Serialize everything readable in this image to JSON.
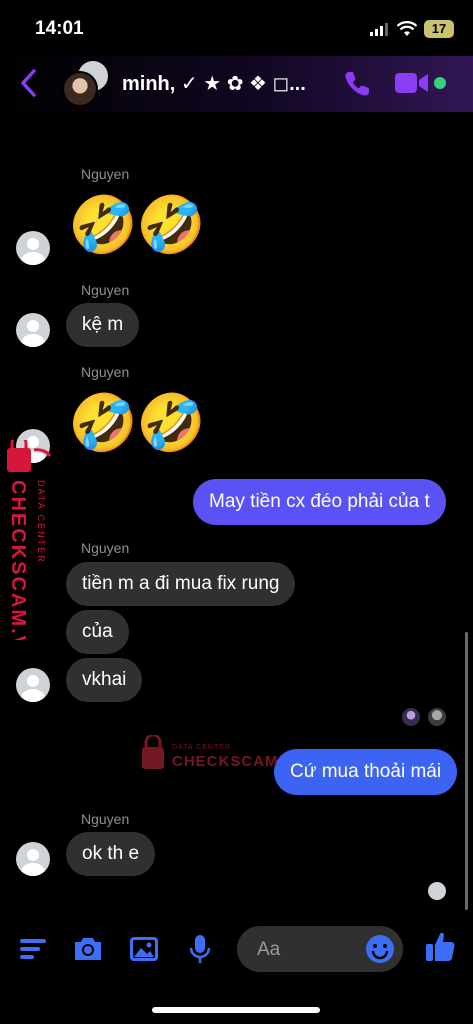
{
  "status_bar": {
    "time": "14:01",
    "battery": "17"
  },
  "header": {
    "title": "minh, ✓ ★ ✿ ❖ ◻..."
  },
  "colors": {
    "accent": "#8b3cf5",
    "bubble_out": "#5b52f6",
    "bubble_out_2": "#3c63f2",
    "bubble_in": "#303030",
    "online": "#35d07f",
    "watermark": "#d6173b"
  },
  "messages": {
    "top_emojis": "🤣🤣🤣",
    "sender_1": "Nguyen",
    "emojis_1": [
      "🤣",
      "🤣"
    ],
    "sender_2": "Nguyen",
    "msg_2": "kệ m",
    "sender_3": "Nguyen",
    "emojis_3": [
      "🤣",
      "🤣"
    ],
    "out_1": "May tiền cx đéo phải của t",
    "sender_4": "Nguyen",
    "msg_4a": "tiền m a đi mua fix rung",
    "msg_4b": "của",
    "msg_4c": "vkhai",
    "out_2": "Cứ mua thoải mái",
    "sender_5": "Nguyen",
    "msg_5": "ok th e"
  },
  "watermark": {
    "top": "DATA CENTER",
    "brand": "CHECKSCAM.VN"
  },
  "composer": {
    "placeholder": "Aa"
  },
  "icons": [
    "back-icon",
    "phone-icon",
    "video-icon",
    "menu-icon",
    "camera-icon",
    "image-icon",
    "mic-icon",
    "smile-icon",
    "thumbs-up-icon"
  ]
}
